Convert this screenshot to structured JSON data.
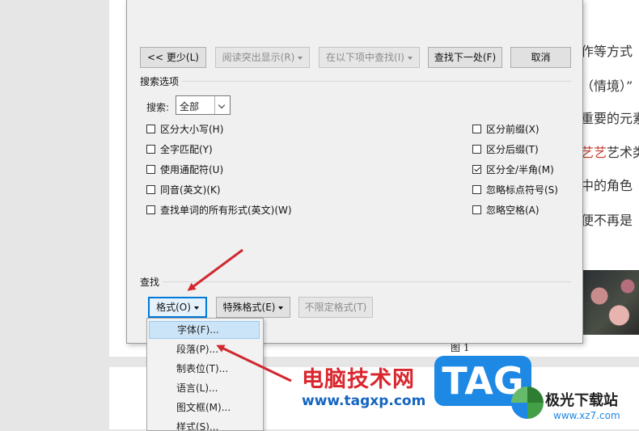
{
  "document": {
    "lines": [
      "作等方式",
      "（情境）”",
      "重要的元素",
      "艺术类",
      "中的角色",
      "便不再是"
    ],
    "highlight_text": "艺艺",
    "figure_caption": "图 1"
  },
  "dialog": {
    "buttons": {
      "less": "<< 更少(L)",
      "reading_highlight": "阅读突出显示(R)",
      "find_in": "在以下项中查找(I)",
      "find_next": "查找下一处(F)",
      "cancel": "取消"
    },
    "search_options_label": "搜索选项",
    "search_label": "搜索:",
    "search_value": "全部",
    "options_left": [
      {
        "label": "区分大小写(H)",
        "checked": false
      },
      {
        "label": "全字匹配(Y)",
        "checked": false
      },
      {
        "label": "使用通配符(U)",
        "checked": false
      },
      {
        "label": "同音(英文)(K)",
        "checked": false
      },
      {
        "label": "查找单词的所有形式(英文)(W)",
        "checked": false
      }
    ],
    "options_right": [
      {
        "label": "区分前缀(X)",
        "checked": false
      },
      {
        "label": "区分后缀(T)",
        "checked": false
      },
      {
        "label": "区分全/半角(M)",
        "checked": true
      },
      {
        "label": "忽略标点符号(S)",
        "checked": false
      },
      {
        "label": "忽略空格(A)",
        "checked": false
      }
    ],
    "find_label": "查找",
    "format_button": "格式(O)",
    "special_button": "特殊格式(E)",
    "no_format_button": "不限定格式(T)"
  },
  "format_menu": {
    "items": [
      "字体(F)...",
      "段落(P)...",
      "制表位(T)...",
      "语言(L)...",
      "图文框(M)...",
      "样式(S)..."
    ]
  },
  "watermark": {
    "cn_text": "电脑技术网",
    "url": "www.tagxp.com",
    "tag": "TAG",
    "site_name": "极光下载站",
    "site_url": "www.xz7.com"
  },
  "colors": {
    "arrow": "#d0282d",
    "accent": "#0078d7"
  }
}
